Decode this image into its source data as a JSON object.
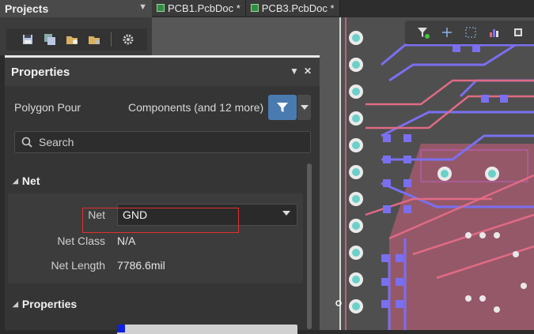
{
  "projects": {
    "title": "Projects"
  },
  "tabs": [
    {
      "label": "PCB1.PcbDoc *"
    },
    {
      "label": "PCB3.PcbDoc *"
    }
  ],
  "properties": {
    "title": "Properties",
    "object_type": "Polygon Pour",
    "filter_summary": "Components (and 12 more)",
    "search_placeholder": "Search",
    "net_section": "Net",
    "net_label": "Net",
    "net_value": "GND",
    "net_class_label": "Net Class",
    "net_class_value": "N/A",
    "net_length_label": "Net Length",
    "net_length_value": "7786.6mil",
    "properties_section": "Properties"
  },
  "colors": {
    "accent_filter": "#4a7bb0",
    "highlight_box": "#e03030",
    "trace_top": "#e06a84",
    "trace_bottom": "#7a6ff0",
    "pad": "#6ad0c8"
  }
}
